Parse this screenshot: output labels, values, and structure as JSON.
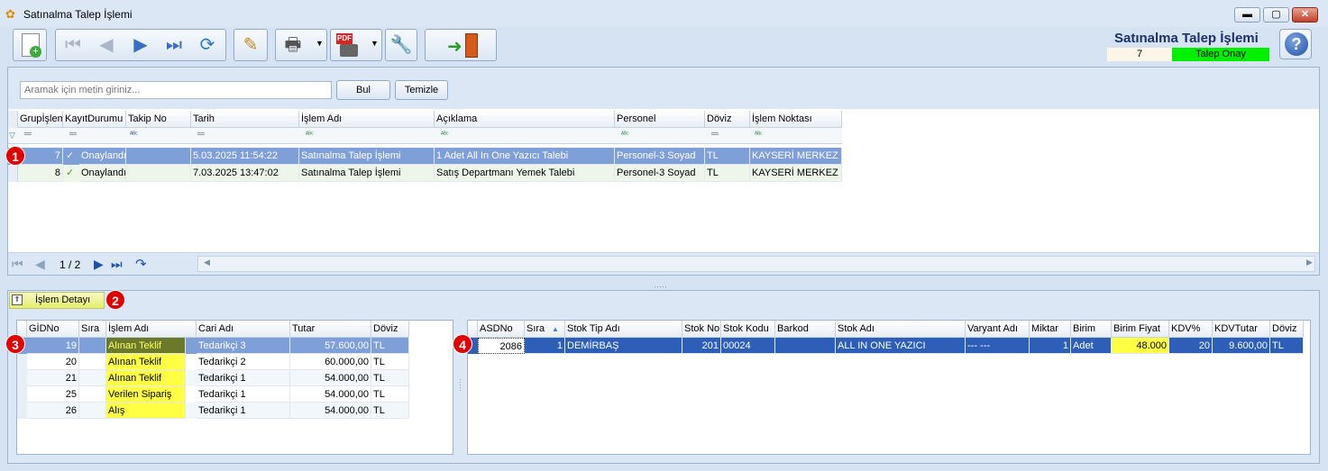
{
  "window": {
    "title": "Satınalma Talep İşlemi"
  },
  "header": {
    "title": "Satınalma Talep İşlemi",
    "number": "7",
    "status": "Talep Onay",
    "status_color": "#00f000"
  },
  "toolbar": {
    "icons": [
      "new-icon",
      "first-record-icon",
      "previous-record-icon",
      "next-record-icon",
      "last-record-icon",
      "refresh-icon",
      "edit-icon",
      "print-icon",
      "pdf-export-icon",
      "tools-icon",
      "exit-icon",
      "help-icon"
    ]
  },
  "search": {
    "placeholder": "Aramak için metin giriniz...",
    "find_label": "Bul",
    "clear_label": "Temizle"
  },
  "main_grid": {
    "columns": [
      "GrupİşlemNo",
      "KayıtDurumu",
      "Takip No",
      "Tarih",
      "İşlem Adı",
      "Açıklama",
      "Personel",
      "Döviz",
      "İşlem Noktası"
    ],
    "rows": [
      {
        "grup": "7",
        "durum": "Onaylandı",
        "takip": "",
        "tarih": "5.03.2025 11:54:22",
        "islem": "Satınalma Talep İşlemi",
        "aciklama": "1 Adet All In One Yazıcı Talebi",
        "personel": "Personel-3 Soyad",
        "doviz": "TL",
        "nokta": "KAYSERİ MERKEZ"
      },
      {
        "grup": "8",
        "durum": "Onaylandı",
        "takip": "",
        "tarih": "7.03.2025 13:47:02",
        "islem": "Satınalma Talep İşlemi",
        "aciklama": "Satış Departmanı Yemek Talebi",
        "personel": "Personel-3 Soyad",
        "doviz": "TL",
        "nokta": "KAYSERİ MERKEZ"
      }
    ],
    "pager": "1 / 2"
  },
  "markers": [
    "1",
    "2",
    "3",
    "4"
  ],
  "detail": {
    "tab_label": "İşlem Detayı",
    "left_grid": {
      "columns": [
        "GİDNo",
        "Sıra",
        "İşlem Adı",
        "Cari Adı",
        "Tutar",
        "Döviz"
      ],
      "rows": [
        {
          "gid": "19",
          "sira": "",
          "islem": "Alınan Teklif",
          "cari": "Tedarikçi 3",
          "tutar": "57.600,00",
          "doviz": "TL"
        },
        {
          "gid": "20",
          "sira": "",
          "islem": "Alınan Teklif",
          "cari": "Tedarikçi 2",
          "tutar": "60.000,00",
          "doviz": "TL"
        },
        {
          "gid": "21",
          "sira": "",
          "islem": "Alınan Teklif",
          "cari": "Tedarikçi 1",
          "tutar": "54.000,00",
          "doviz": "TL"
        },
        {
          "gid": "25",
          "sira": "",
          "islem": "Verilen Sipariş",
          "cari": "Tedarikçi 1",
          "tutar": "54.000,00",
          "doviz": "TL"
        },
        {
          "gid": "26",
          "sira": "",
          "islem": "Alış",
          "cari": "Tedarikçi 1",
          "tutar": "54.000,00",
          "doviz": "TL"
        }
      ]
    },
    "right_grid": {
      "columns": [
        "ASDNo",
        "Sıra",
        "Stok Tip Adı",
        "Stok No",
        "Stok Kodu",
        "Barkod",
        "Stok Adı",
        "Varyant Adı",
        "Miktar",
        "Birim",
        "Birim Fiyat",
        "KDV%",
        "KDVTutar",
        "Döviz"
      ],
      "row": {
        "asd": "2086",
        "sira": "1",
        "tip": "DEMİRBAŞ",
        "stokno": "201",
        "kod": "00024",
        "barkod": "",
        "ad": "ALL IN ONE YAZICI",
        "varyant": "--- ---",
        "miktar": "1",
        "birim": "Adet",
        "fiyat": "48.000",
        "kdv": "20",
        "kdvtutar": "9.600,00",
        "doviz": "TL"
      }
    }
  }
}
